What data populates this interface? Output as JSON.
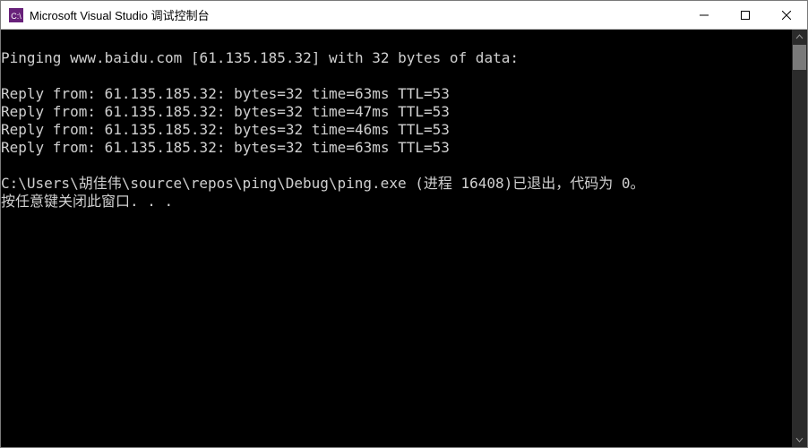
{
  "window": {
    "title": "Microsoft Visual Studio 调试控制台",
    "icon_label": "vs-console-icon"
  },
  "console": {
    "lines": [
      "",
      "Pinging www.baidu.com [61.135.185.32] with 32 bytes of data:",
      "",
      "Reply from: 61.135.185.32: bytes=32 time=63ms TTL=53",
      "Reply from: 61.135.185.32: bytes=32 time=47ms TTL=53",
      "Reply from: 61.135.185.32: bytes=32 time=46ms TTL=53",
      "Reply from: 61.135.185.32: bytes=32 time=63ms TTL=53",
      "",
      "C:\\Users\\胡佳伟\\source\\repos\\ping\\Debug\\ping.exe (进程 16408)已退出，代码为 0。",
      "按任意键关闭此窗口. . ."
    ]
  },
  "colors": {
    "console_bg": "#000000",
    "console_fg": "#d0d0d0",
    "titlebar_bg": "#ffffff",
    "icon_bg": "#68217a",
    "scrollbar_thumb": "#7a7a7a"
  }
}
